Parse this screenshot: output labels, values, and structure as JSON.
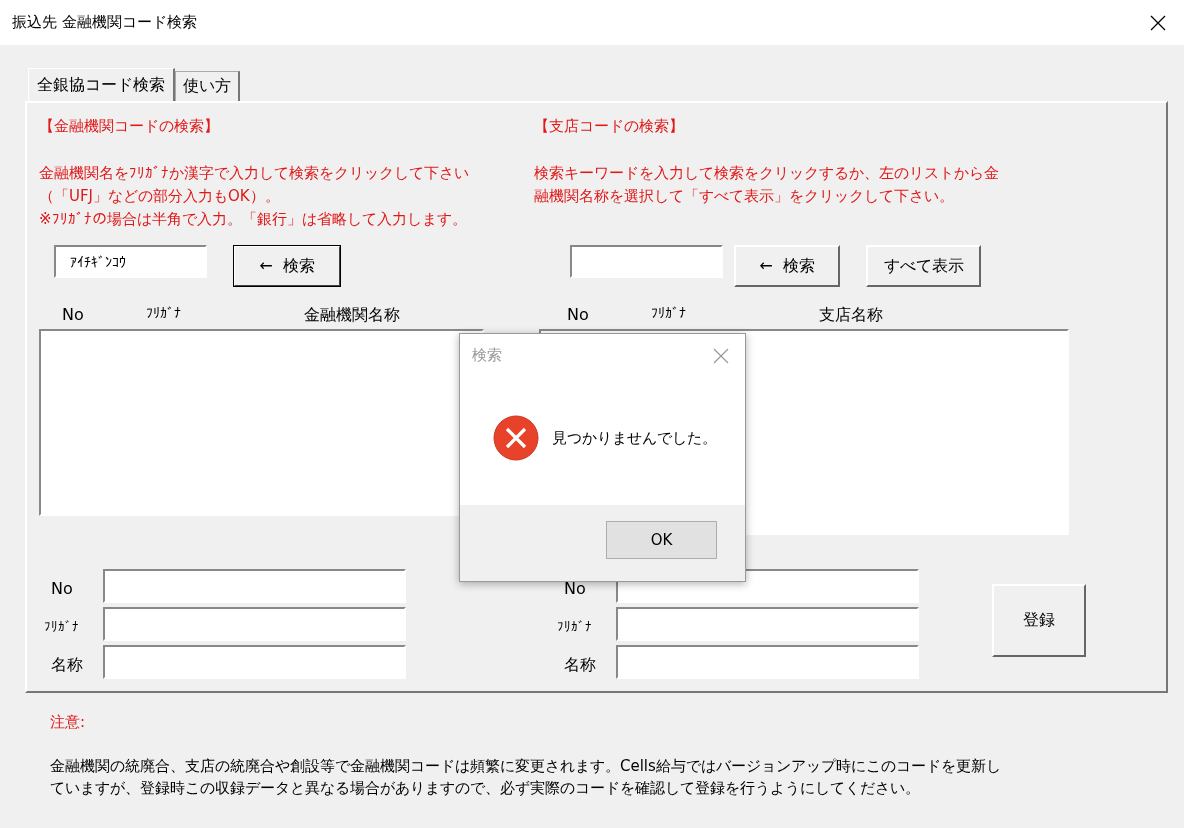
{
  "window": {
    "title": "振込先 金融機関コード検索"
  },
  "tabs": [
    {
      "label": "全銀協コード検索",
      "selected": true
    },
    {
      "label": "使い方",
      "selected": false
    }
  ],
  "bank_search": {
    "heading": "【金融機関コードの検索】",
    "lines": [
      "金融機関名をﾌﾘｶﾞﾅか漢字で入力して検索をクリックして下さい",
      "（「UFJ」などの部分入力もOK）。",
      "※ﾌﾘｶﾞﾅの場合は半角で入力。「銀行」は省略して入力します。"
    ],
    "search_value": "ｱｲﾁｷﾞﾝｺｳ",
    "buttons": [
      {
        "label": "←  検索",
        "default": true
      }
    ],
    "columns": [
      "No",
      "ﾌﾘｶﾞﾅ",
      "金融機関名称"
    ],
    "fields": [
      "No",
      "ﾌﾘｶﾞﾅ",
      "名称"
    ]
  },
  "branch_search": {
    "heading": "【支店コードの検索】",
    "lines": [
      "検索キーワードを入力して検索をクリックするか、左のリストから金",
      "融機関名称を選択して「すべて表示」をクリックして下さい。"
    ],
    "buttons": [
      {
        "label": "←  検索",
        "default": false
      },
      {
        "label": "すべて表示",
        "default": false
      }
    ],
    "columns": [
      "No",
      "ﾌﾘｶﾞﾅ",
      "支店名称"
    ],
    "fields": [
      "No",
      "ﾌﾘｶﾞﾅ",
      "名称"
    ]
  },
  "register_button": "登録",
  "notice": {
    "heading": "注意:",
    "lines": [
      "金融機関の統廃合、支店の統廃合や創設等で金融機関コードは頻繁に変更されます。Cells給与ではバージョンアップ時にこのコードを更新し",
      "ていますが、登録時この収録データと異なる場合がありますので、必ず実際のコードを確認して登録を行うようにしてください。"
    ]
  },
  "dialog": {
    "title": "検索",
    "kind": "error",
    "message": "見つかりませんでした。",
    "buttons": [
      "OK"
    ]
  }
}
